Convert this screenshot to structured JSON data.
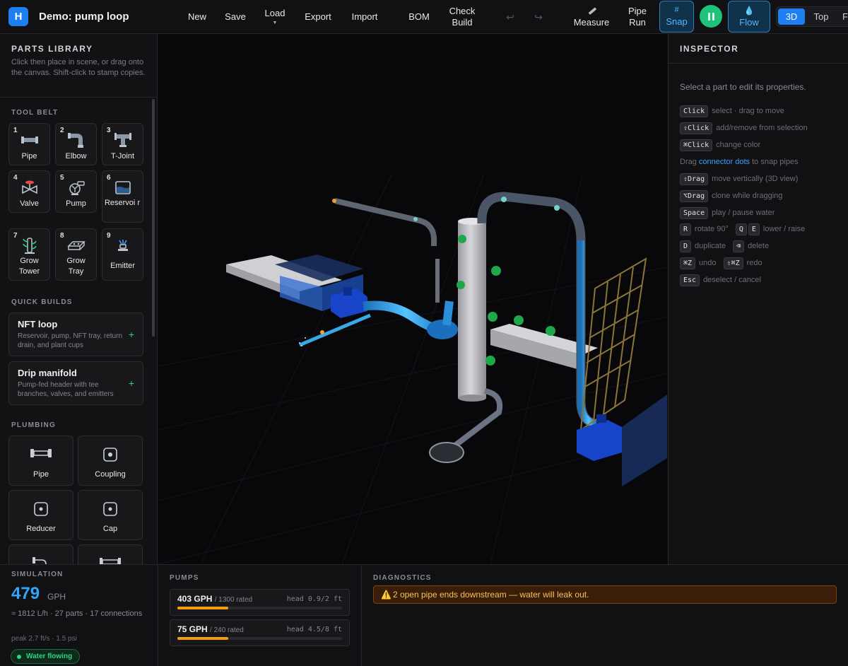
{
  "app": {
    "logo_letter": "H",
    "title": "Demo: pump loop"
  },
  "toolbar": {
    "new": "New",
    "save": "Save",
    "load": "Load",
    "export": "Export",
    "import": "Import",
    "bom": "BOM",
    "check_build_1": "Check",
    "check_build_2": "Build",
    "undo_icon": "↩",
    "redo_icon": "↪",
    "measure": "Measure",
    "pipe_run_1": "Pipe",
    "pipe_run_2": "Run",
    "snap": "Snap",
    "flow": "Flow",
    "views": [
      "3D",
      "Top",
      "F"
    ]
  },
  "parts_library": {
    "title": "PARTS LIBRARY",
    "subtitle": "Click then place in scene, or drag onto the canvas. Shift-click to stamp copies.",
    "tool_belt_title": "TOOL BELT",
    "tools": [
      {
        "num": "1",
        "label": "Pipe",
        "icon": "pipe-icon"
      },
      {
        "num": "2",
        "label": "Elbow",
        "icon": "elbow-icon"
      },
      {
        "num": "3",
        "label": "T-Joint",
        "icon": "t-joint-icon"
      },
      {
        "num": "4",
        "label": "Valve",
        "icon": "valve-icon"
      },
      {
        "num": "5",
        "label": "Pump",
        "icon": "pump-icon"
      },
      {
        "num": "6",
        "label": "Reservoi\nr",
        "icon": "reservoir-icon"
      },
      {
        "num": "7",
        "label": "Grow\nTower",
        "icon": "grow-tower-icon"
      },
      {
        "num": "8",
        "label": "Grow\nTray",
        "icon": "grow-tray-icon"
      },
      {
        "num": "9",
        "label": "Emitter",
        "icon": "emitter-icon"
      }
    ],
    "quick_builds_title": "QUICK BUILDS",
    "quick_builds": [
      {
        "title": "NFT loop",
        "desc": "Reservoir, pump, NFT tray, return drain, and plant cups"
      },
      {
        "title": "Drip manifold",
        "desc": "Pump-fed header with tee branches, valves, and emitters"
      }
    ],
    "plumbing_title": "PLUMBING",
    "plumbing": [
      {
        "label": "Pipe"
      },
      {
        "label": "Coupling"
      },
      {
        "label": "Reducer"
      },
      {
        "label": "Cap"
      }
    ]
  },
  "inspector": {
    "title": "INSPECTOR",
    "hint": "Select a part to edit its properties.",
    "shortcuts": [
      {
        "keys": [
          "Click"
        ],
        "text": "select · drag to move"
      },
      {
        "keys": [
          "⇧Click"
        ],
        "text": "add/remove from selection"
      },
      {
        "keys": [
          "⌘Click"
        ],
        "text": "change color"
      },
      {
        "keys": [],
        "prefix": "Drag ",
        "link": "connector dots",
        "text": " to snap pipes"
      },
      {
        "keys": [
          "⇧Drag"
        ],
        "text": "move vertically (3D view)"
      },
      {
        "keys": [
          "⌥Drag"
        ],
        "text": "clone while dragging"
      },
      {
        "keys": [
          "Space"
        ],
        "text": "play / pause water"
      },
      {
        "keys": [
          "R"
        ],
        "text": "rotate 90°",
        "keys2": [
          "Q",
          "E"
        ],
        "text2": "lower / raise"
      },
      {
        "keys": [
          "D"
        ],
        "text": "duplicate",
        "keys2": [
          "⌫"
        ],
        "text2": "delete"
      },
      {
        "keys": [
          "⌘Z"
        ],
        "text": "undo",
        "keys2": [
          "⇧⌘Z"
        ],
        "text2": "redo"
      },
      {
        "keys": [
          "Esc"
        ],
        "text": "deselect / cancel"
      }
    ]
  },
  "simulation": {
    "title": "SIMULATION",
    "flow_value": "479",
    "flow_unit": "GPH",
    "details": "≈ 1812 L/h · 27 parts · 17 connections",
    "peak": "peak 2.7 ft/s · 1.5 psi",
    "status": "Water flowing"
  },
  "pumps": {
    "title": "PUMPS",
    "items": [
      {
        "flow": "403 GPH",
        "rated": "/ 1300 rated",
        "head": "head 0.9/2 ft",
        "load_fraction": 0.31
      },
      {
        "flow": "75 GPH",
        "rated": "/ 240 rated",
        "head": "head 4.5/8 ft",
        "load_fraction": 0.31
      }
    ]
  },
  "diagnostics": {
    "title": "DIAGNOSTICS",
    "warning_icon": "warning-icon",
    "message": "2 open pipe ends downstream — water will leak out."
  },
  "colors": {
    "accent": "#1d7ff0",
    "water": "#2ea8ff",
    "play": "#1fc27a",
    "warning": "#f59e0b"
  }
}
